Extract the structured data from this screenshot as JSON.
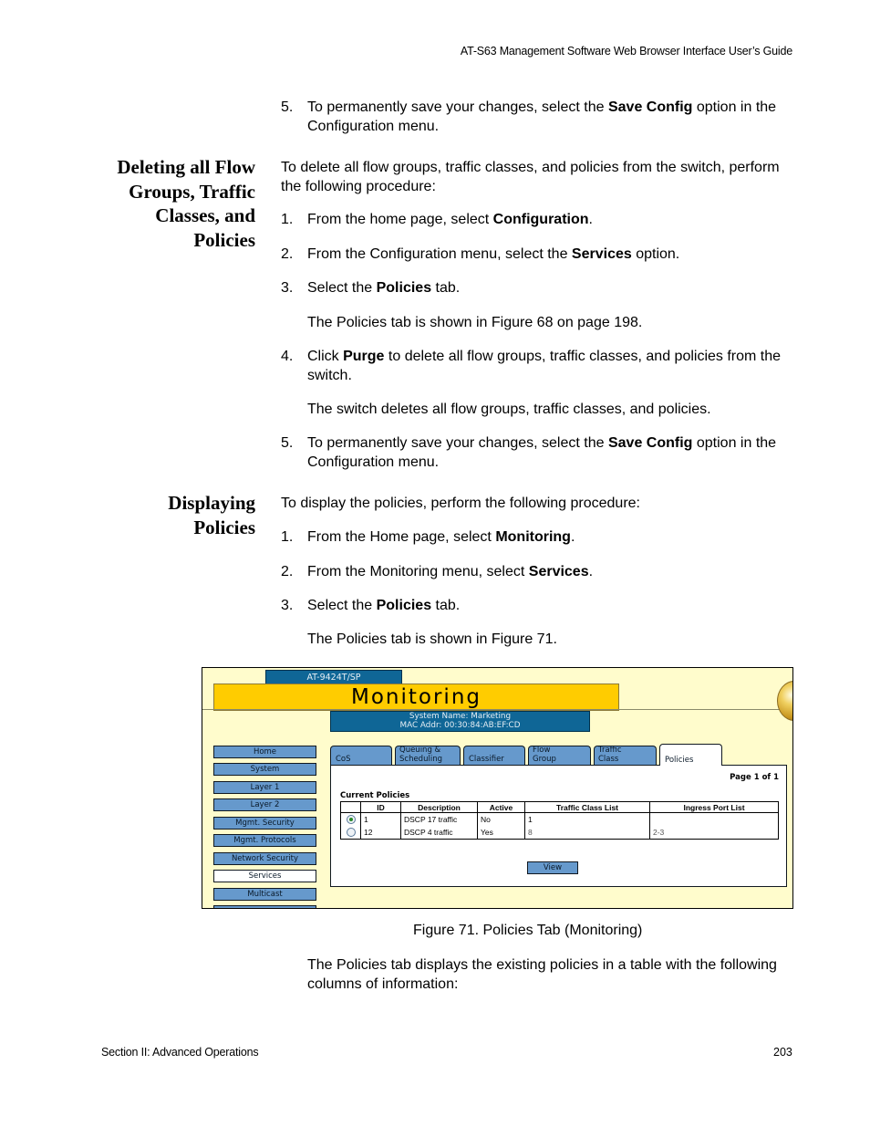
{
  "running_header": "AT-S63 Management Software Web Browser Interface User’s Guide",
  "top_step": {
    "num": "5.",
    "pre": "To permanently save your changes, select the ",
    "bold": "Save Config",
    "post": " option in the Configuration menu."
  },
  "section_delete": {
    "heading": [
      "Deleting all Flow",
      "Groups, Traffic",
      "Classes, and",
      "Policies"
    ],
    "intro": "To delete all flow groups, traffic classes, and policies from the switch, perform the following procedure:",
    "steps": [
      {
        "num": "1.",
        "pre": "From the home page, select ",
        "bold": "Configuration",
        "post": "."
      },
      {
        "num": "2.",
        "pre": "From the Configuration menu, select the ",
        "bold": "Services",
        "post": " option."
      },
      {
        "num": "3.",
        "pre": "Select the ",
        "bold": "Policies",
        "post": " tab."
      },
      {
        "num": "4.",
        "pre": "Click ",
        "bold": "Purge",
        "post": " to delete all flow groups, traffic classes, and policies from the switch."
      },
      {
        "num": "5.",
        "pre": "To permanently save your changes, select the ",
        "bold": "Save Config",
        "post": " option in the Configuration menu."
      }
    ],
    "note_after_3": "The Policies tab is shown in Figure 68 on page 198.",
    "note_after_4": "The switch deletes all flow groups, traffic classes, and policies."
  },
  "section_display": {
    "heading": [
      "Displaying",
      "Policies"
    ],
    "intro": "To display the policies, perform the following procedure:",
    "steps": [
      {
        "num": "1.",
        "pre": "From the Home page, select ",
        "bold": "Monitoring",
        "post": "."
      },
      {
        "num": "2.",
        "pre": "From the Monitoring menu, select ",
        "bold": "Services",
        "post": "."
      },
      {
        "num": "3.",
        "pre": "Select the ",
        "bold": "Policies",
        "post": " tab."
      }
    ],
    "note_after_3": "The Policies tab is shown in Figure 71."
  },
  "figure": {
    "model": "AT-9424T/SP",
    "banner": "Monitoring",
    "system_name": "System Name: Marketing",
    "mac_addr": "MAC Addr: 00:30:84:AB:EF:CD",
    "nav": [
      "Home",
      "System",
      "Layer 1",
      "Layer 2",
      "Mgmt. Security",
      "Mgmt. Protocols",
      "Network Security",
      "Services",
      "Multicast"
    ],
    "nav_active": "Services",
    "tabs": [
      {
        "line1": "",
        "line2": "CoS"
      },
      {
        "line1": "Queuing &",
        "line2": "Scheduling"
      },
      {
        "line1": "",
        "line2": "Classifier"
      },
      {
        "line1": "Flow",
        "line2": "Group"
      },
      {
        "line1": "Traffic",
        "line2": "Class"
      },
      {
        "line1": "",
        "line2": "Policies"
      }
    ],
    "active_tab": "Policies",
    "page_info": "Page 1 of 1",
    "table_title": "Current Policies",
    "columns": [
      "",
      "ID",
      "Description",
      "Active",
      "Traffic Class List",
      "Ingress Port List"
    ],
    "rows": [
      {
        "selected": true,
        "id": "1",
        "description": "DSCP 17 traffic",
        "active": "No",
        "traffic_class_list": "1",
        "ingress_port_list": ""
      },
      {
        "selected": false,
        "id": "12",
        "description": "DSCP 4 traffic",
        "active": "Yes",
        "traffic_class_list": "8",
        "ingress_port_list": "2-3"
      }
    ],
    "view_button": "View",
    "colors": {
      "banner": "#ffcc00",
      "header_blue": "#0f6696",
      "button_blue": "#6699cc",
      "background": "#fffccc"
    }
  },
  "caption": "Figure 71. Policies Tab (Monitoring)",
  "closing_paragraph": "The Policies tab displays the existing policies in a table with the following columns of information:",
  "footer": {
    "section": "Section II: Advanced Operations",
    "page": "203"
  }
}
